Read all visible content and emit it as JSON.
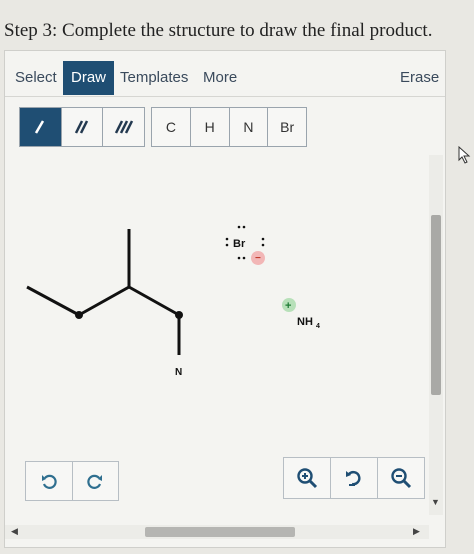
{
  "question": {
    "title": "Step 3: Complete the structure to draw the final product."
  },
  "menu": {
    "select": "Select",
    "draw": "Draw",
    "templates": "Templates",
    "more": "More",
    "erase": "Erase"
  },
  "toolbar": {
    "bonds": [
      {
        "name": "single-bond",
        "icon": "single-bond-icon"
      },
      {
        "name": "double-bond",
        "icon": "double-bond-icon"
      },
      {
        "name": "triple-bond",
        "icon": "triple-bond-icon"
      }
    ],
    "atoms": [
      "C",
      "H",
      "N",
      "Br"
    ]
  },
  "canvas": {
    "molecule_label": "N",
    "bromide": {
      "symbol": "Br",
      "charge": "−"
    },
    "ammonium": {
      "symbol": "NH",
      "subscript": "4",
      "charge": "+"
    }
  },
  "controls": {
    "undo_icon": "undo-icon",
    "redo_icon": "redo-icon",
    "zoom_in_icon": "zoom-in-icon",
    "reset_icon": "reset-view-icon",
    "zoom_out_icon": "zoom-out-icon"
  },
  "colors": {
    "active": "#1f4e73",
    "positive_charge": "#2ea44f",
    "negative_charge": "#e0555a"
  }
}
